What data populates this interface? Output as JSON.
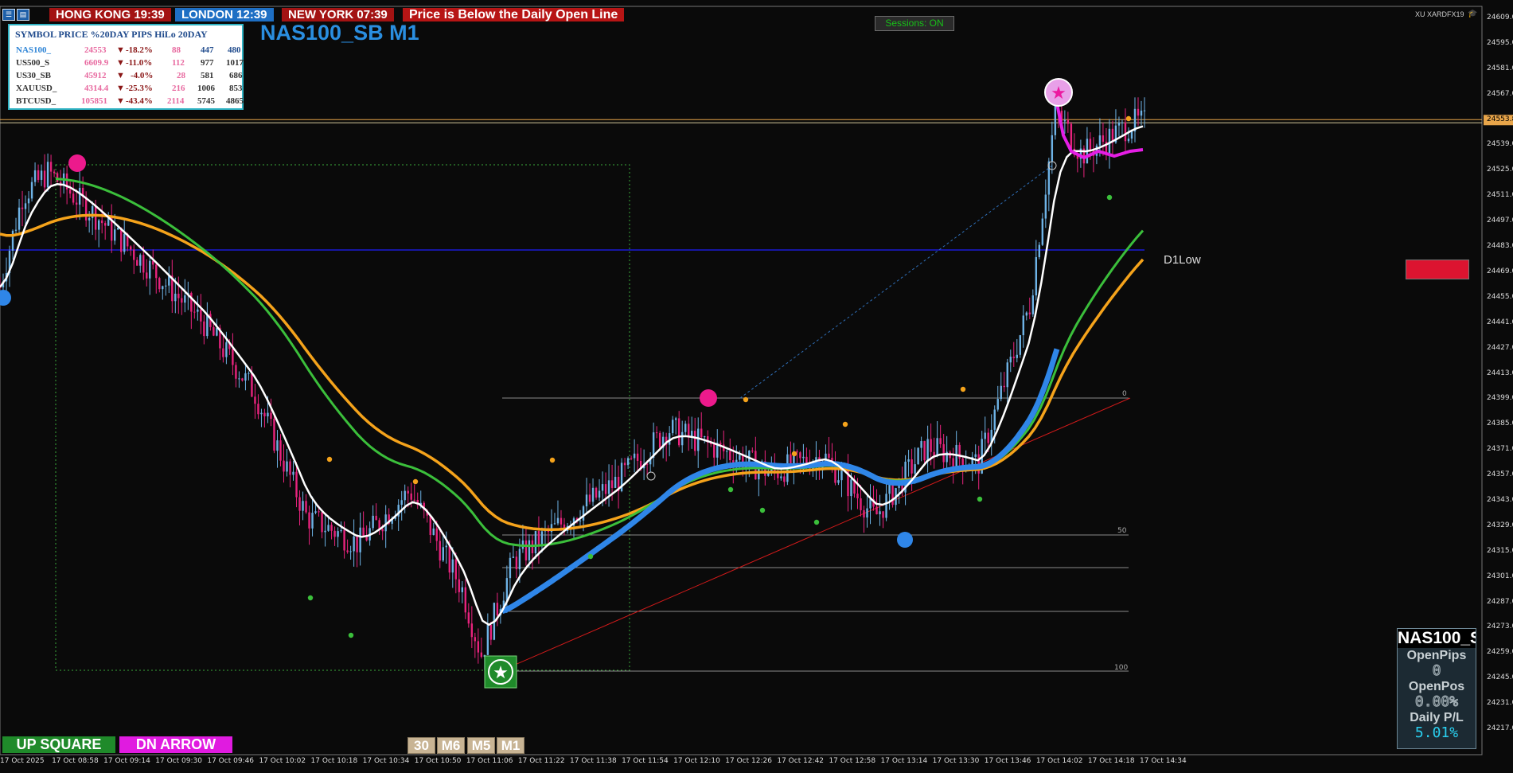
{
  "sessions": [
    {
      "label": "HONG KONG 19:39",
      "color": "#a31313"
    },
    {
      "label": "LONDON  12:39",
      "color": "#1e6fc4"
    },
    {
      "label": "NEW YORK  07:39",
      "color": "#a31313"
    }
  ],
  "alert": {
    "text": "Price is Below the Daily Open Line",
    "color": "#b71515"
  },
  "sessions_button": {
    "label": "Sessions: ON"
  },
  "chart_title": "NAS100_SB M1",
  "broker_label": "XU XARDFX19",
  "symbol_table": {
    "header": "SYMBOL PRICE %20DAY PIPS HiLo 20DAY",
    "rows": [
      {
        "symbol": "NAS100_",
        "price": "24553",
        "arrow": "▼",
        "pct": "-18.2%",
        "pips": "88",
        "hilo": "447",
        "d20": "480"
      },
      {
        "symbol": "US500_S",
        "price": "6609.9",
        "arrow": "▼",
        "pct": "-11.0%",
        "pips": "112",
        "hilo": "977",
        "d20": "1017"
      },
      {
        "symbol": "US30_SB",
        "price": "45912",
        "arrow": "▼",
        "pct": "-4.0%",
        "pips": "28",
        "hilo": "581",
        "d20": "686"
      },
      {
        "symbol": "XAUUSD_",
        "price": "4314.4",
        "arrow": "▼",
        "pct": "-25.3%",
        "pips": "216",
        "hilo": "1006",
        "d20": "853"
      },
      {
        "symbol": "BTCUSD_",
        "price": "105851",
        "arrow": "▼",
        "pct": "-43.4%",
        "pips": "2114",
        "hilo": "5745",
        "d20": "4865"
      }
    ]
  },
  "d1_label": "D1Low",
  "current_price_label": "24553.8",
  "fib_labels": [
    "0",
    "50",
    "100"
  ],
  "y_axis": [
    "24609.0",
    "24595.0",
    "24581.0",
    "24567.0",
    "24553.8",
    "24539.0",
    "24525.0",
    "24511.0",
    "24497.0",
    "24483.0",
    "24469.0",
    "24455.0",
    "24441.0",
    "24427.0",
    "24413.0",
    "24399.0",
    "24385.0",
    "24371.0",
    "24357.0",
    "24343.0",
    "24329.0",
    "24315.0",
    "24301.0",
    "24287.0",
    "24273.0",
    "24259.0",
    "24245.0",
    "24231.0",
    "24217.0"
  ],
  "x_axis": [
    "17 Oct 2025",
    "17 Oct 08:58",
    "17 Oct 09:14",
    "17 Oct 09:30",
    "17 Oct 09:46",
    "17 Oct 10:02",
    "17 Oct 10:18",
    "17 Oct 10:34",
    "17 Oct 10:50",
    "17 Oct 11:06",
    "17 Oct 11:22",
    "17 Oct 11:38",
    "17 Oct 11:54",
    "17 Oct 12:10",
    "17 Oct 12:26",
    "17 Oct 12:42",
    "17 Oct 12:58",
    "17 Oct 13:14",
    "17 Oct 13:30",
    "17 Oct 13:46",
    "17 Oct 14:02",
    "17 Oct 14:18",
    "17 Oct 14:34"
  ],
  "bottom_buttons": {
    "up": {
      "label": "UP SQUARE",
      "color": "#1f8a2a"
    },
    "dn": {
      "label": "DN ARROW",
      "color": "#e01be0"
    }
  },
  "timeframes": [
    "30",
    "M6",
    "M5",
    "M1"
  ],
  "info_panel": {
    "title": "NAS100_S",
    "open_pips_label": "OpenPips",
    "open_pips_value": "0",
    "open_pos_label": "OpenPos",
    "open_pos_value": "0.00%",
    "daily_pl_label": "Daily P/L",
    "daily_pl_value": "5.01%"
  },
  "colors": {
    "bull_candle": "#6eb3e6",
    "bear_candle": "#e8237d",
    "ema_fast": "#ffffff",
    "ema_orange": "#f5a31b",
    "ema_green": "#3bbf3b",
    "ema_blue": "#2f86e8",
    "ema_magenta": "#e51ee5",
    "d1_line": "#1b1bd6",
    "price_line": "#e8a54a",
    "sell_box": "#dc1430"
  },
  "chart_data": {
    "type": "candlestick",
    "title": "NAS100_SB M1",
    "ylim": [
      24210,
      24612
    ],
    "key_levels": {
      "d1_low": 24481,
      "current_price": 24553.8
    },
    "indicators": [
      "fast EMA (white)",
      "slow EMA (orange)",
      "EMA (green)",
      "EMA (blue)",
      "EMA (magenta)"
    ],
    "close_path": [
      {
        "t": "08:43",
        "v": 24460
      },
      {
        "t": "08:50",
        "v": 24512
      },
      {
        "t": "08:58",
        "v": 24525
      },
      {
        "t": "09:14",
        "v": 24498
      },
      {
        "t": "09:30",
        "v": 24470
      },
      {
        "t": "09:46",
        "v": 24440
      },
      {
        "t": "10:02",
        "v": 24400
      },
      {
        "t": "10:18",
        "v": 24330
      },
      {
        "t": "10:34",
        "v": 24315
      },
      {
        "t": "10:50",
        "v": 24345
      },
      {
        "t": "11:06",
        "v": 24290
      },
      {
        "t": "11:12",
        "v": 24252
      },
      {
        "t": "11:22",
        "v": 24305
      },
      {
        "t": "11:38",
        "v": 24328
      },
      {
        "t": "11:54",
        "v": 24350
      },
      {
        "t": "12:10",
        "v": 24380
      },
      {
        "t": "12:26",
        "v": 24368
      },
      {
        "t": "12:42",
        "v": 24355
      },
      {
        "t": "12:58",
        "v": 24365
      },
      {
        "t": "13:14",
        "v": 24330
      },
      {
        "t": "13:30",
        "v": 24370
      },
      {
        "t": "13:46",
        "v": 24360
      },
      {
        "t": "14:02",
        "v": 24450
      },
      {
        "t": "14:10",
        "v": 24560
      },
      {
        "t": "14:18",
        "v": 24535
      },
      {
        "t": "14:34",
        "v": 24553
      }
    ]
  }
}
